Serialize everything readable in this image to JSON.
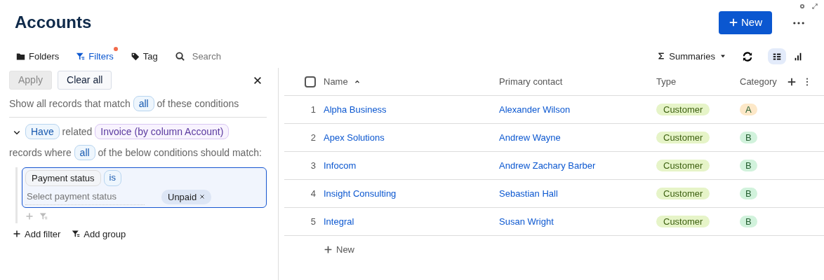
{
  "title": "Accounts",
  "new_button": "New",
  "toolbar": [
    {
      "kind": "folders",
      "label": "Folders",
      "selected": false,
      "indicator": false
    },
    {
      "kind": "filters",
      "label": "Filters",
      "selected": true,
      "indicator": true
    },
    {
      "kind": "tag",
      "label": "Tag",
      "selected": false,
      "indicator": false
    }
  ],
  "search": {
    "placeholder": "Search"
  },
  "summaries": "Summaries",
  "views": [
    {
      "kind": "grid",
      "selected": true
    },
    {
      "kind": "chart",
      "selected": false
    }
  ],
  "filter_panel": {
    "apply": {
      "label": "Apply",
      "disabled": true
    },
    "clear": "Clear all",
    "match": {
      "before": "Show all records that match",
      "chip": "all",
      "after": "of these conditions"
    },
    "group": {
      "expanded": true,
      "quantifier": "Have",
      "word": "related",
      "relation": "Invoice (by column Account)",
      "before": "records where",
      "chip": "all",
      "after": "of the below conditions should match:",
      "condition": {
        "field": "Payment status",
        "operator": "is",
        "placeholder": "Select payment status",
        "values": [
          "Unpaid"
        ]
      }
    },
    "add_filter": "Add filter",
    "add_group": "Add group"
  },
  "table": {
    "select_all": {
      "checked": false
    },
    "columns": [
      {
        "label": "Name",
        "sort_ascending": true
      },
      {
        "label": "Primary contact"
      },
      {
        "label": "Type"
      },
      {
        "label": "Category"
      }
    ],
    "rows": [
      {
        "number": "1",
        "name": "Alpha Business",
        "contact": "Alexander Wilson",
        "type": "Customer",
        "category": {
          "label": "A",
          "color": "#fde8c8"
        }
      },
      {
        "number": "2",
        "name": "Apex Solutions",
        "contact": "Andrew Wayne",
        "type": "Customer",
        "category": {
          "label": "B",
          "color": "#d1f2dc"
        }
      },
      {
        "number": "3",
        "name": "Infocom",
        "contact": "Andrew Zachary Barber",
        "type": "Customer",
        "category": {
          "label": "B",
          "color": "#d1f2dc"
        }
      },
      {
        "number": "4",
        "name": "Insight Consulting",
        "contact": "Sebastian Hall",
        "type": "Customer",
        "category": {
          "label": "B",
          "color": "#d1f2dc"
        }
      },
      {
        "number": "5",
        "name": "Integral",
        "contact": "Susan Wright",
        "type": "Customer",
        "category": {
          "label": "B",
          "color": "#d1f2dc"
        }
      }
    ],
    "new_row": "New"
  }
}
